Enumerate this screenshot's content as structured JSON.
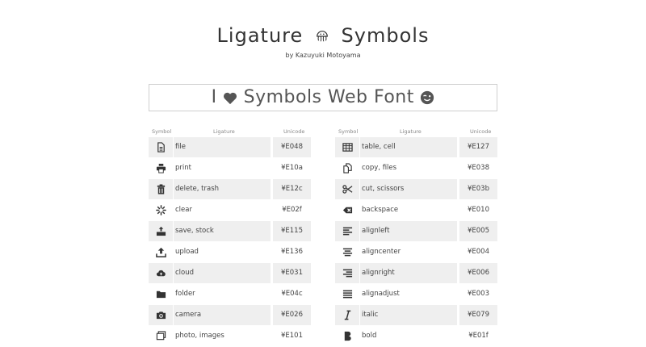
{
  "header": {
    "title_left": "Ligature",
    "title_right": "Symbols",
    "byline": "by Kazuyuki Motoyama"
  },
  "demo": {
    "text_i": "I",
    "text_rest": "Symbols Web Font",
    "heart_icon": "heart-icon",
    "wink_icon": "wink-icon"
  },
  "table_headers": {
    "symbol": "Symbol",
    "ligature": "Ligature",
    "unicode": "Unicode"
  },
  "left_rows": [
    {
      "icon": "file-icon",
      "ligature": "file",
      "unicode": "¥E048"
    },
    {
      "icon": "print-icon",
      "ligature": "print",
      "unicode": "¥E10a"
    },
    {
      "icon": "trash-icon",
      "ligature": "delete, trash",
      "unicode": "¥E12c"
    },
    {
      "icon": "clear-icon",
      "ligature": "clear",
      "unicode": "¥E02f"
    },
    {
      "icon": "save-icon",
      "ligature": "save, stock",
      "unicode": "¥E115"
    },
    {
      "icon": "upload-icon",
      "ligature": "upload",
      "unicode": "¥E136"
    },
    {
      "icon": "cloud-icon",
      "ligature": "cloud",
      "unicode": "¥E031"
    },
    {
      "icon": "folder-icon",
      "ligature": "folder",
      "unicode": "¥E04c"
    },
    {
      "icon": "camera-icon",
      "ligature": "camera",
      "unicode": "¥E026"
    },
    {
      "icon": "images-icon",
      "ligature": "photo, images",
      "unicode": "¥E101"
    }
  ],
  "right_rows": [
    {
      "icon": "table-icon",
      "ligature": "table, cell",
      "unicode": "¥E127"
    },
    {
      "icon": "copy-icon",
      "ligature": "copy, files",
      "unicode": "¥E038"
    },
    {
      "icon": "scissors-icon",
      "ligature": "cut, scissors",
      "unicode": "¥E03b"
    },
    {
      "icon": "backspace-icon",
      "ligature": "backspace",
      "unicode": "¥E010"
    },
    {
      "icon": "align-left-icon",
      "ligature": "alignleft",
      "unicode": "¥E005"
    },
    {
      "icon": "align-center-icon",
      "ligature": "aligncenter",
      "unicode": "¥E004"
    },
    {
      "icon": "align-right-icon",
      "ligature": "alignright",
      "unicode": "¥E006"
    },
    {
      "icon": "align-justify-icon",
      "ligature": "alignadjust",
      "unicode": "¥E003"
    },
    {
      "icon": "italic-icon",
      "ligature": "italic",
      "unicode": "¥E079"
    },
    {
      "icon": "bold-icon",
      "ligature": "bold",
      "unicode": "¥E01f"
    }
  ]
}
